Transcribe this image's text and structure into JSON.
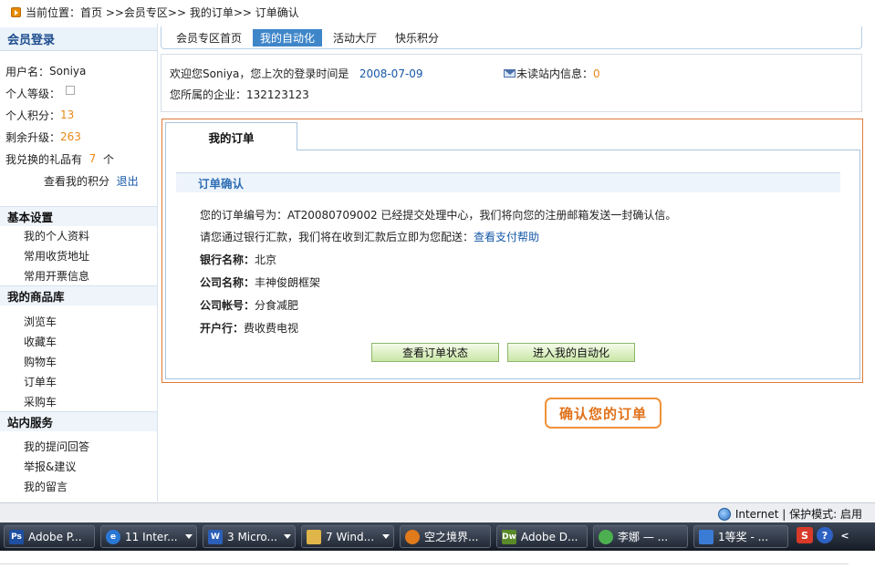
{
  "breadcrumb": {
    "text": "当前位置：首页 >>会员专区>> 我的订单>> 订单确认"
  },
  "sidebar": {
    "login_title": "会员登录",
    "username_label": "用户名：",
    "username": "Soniya",
    "level_label": "个人等级：",
    "points_label": "个人积分：",
    "points": "13",
    "remaining_label": "剩余升级：",
    "remaining": "263",
    "gifts_label": "我兑换的礼品有",
    "gifts_count": "7",
    "gifts_unit": "个",
    "view_points": "查看我的积分",
    "logout": "退出",
    "sections": [
      {
        "title": "基本设置",
        "items": [
          "我的个人资料",
          "常用收货地址",
          "常用开票信息"
        ]
      },
      {
        "title": "我的商品库",
        "items": [
          "浏览车",
          "收藏车",
          "购物车",
          "订单车",
          "采购车"
        ]
      },
      {
        "title": "站内服务",
        "items": [
          "我的提问回答",
          "举报&建议",
          "我的留言"
        ]
      }
    ]
  },
  "tabs": [
    "会员专区首页",
    "我的自动化",
    "活动大厅",
    "快乐积分"
  ],
  "welcome": {
    "greeting": "欢迎您Soniya，您上次的登录时间是",
    "last_login": "2008-07-09",
    "unread_label": "未读站内信息：",
    "unread_count": "0",
    "company_label": "您所属的企业：",
    "company": "132123123"
  },
  "order": {
    "tab_label": "我的订单",
    "section_title": "订单确认",
    "line1": "您的订单编号为：AT20080709002 已经提交处理中心，我们将向您的注册邮箱发送一封确认信。",
    "line2_text": "请您通过银行汇款，我们将在收到汇款后立即为您配送：",
    "line2_link": "查看支付帮助",
    "bank_label": "银行名称：",
    "bank": "北京",
    "company_label": "公司名称：",
    "company": "丰神俊朗框架",
    "account_label": "公司帐号：",
    "account": "分食减肥",
    "branch_label": "开户行：",
    "branch": "费收费电视",
    "btn_status": "查看订单状态",
    "btn_auto": "进入我的自动化"
  },
  "badge": "确认您的订单",
  "status_bar": {
    "zone": "Internet | 保护模式: 启用"
  },
  "taskbar": {
    "buttons": [
      {
        "icon": "Ps",
        "label": "Adobe P...",
        "color": "#1f4fa0"
      },
      {
        "icon": "e",
        "label": "11 Inter...",
        "color": "#2a78d6",
        "bold_prefix": true
      },
      {
        "icon": "W",
        "label": "3 Micro...",
        "color": "#2b5fb8",
        "bold_prefix": true
      },
      {
        "icon": "",
        "label": "7 Wind...",
        "color": "#e0b64a",
        "bold_prefix": true
      },
      {
        "icon": "",
        "label": "空之境界...",
        "color": "#e07a1a"
      },
      {
        "icon": "Dw",
        "label": "Adobe D...",
        "color": "#5a8a2a"
      },
      {
        "icon": "",
        "label": "李娜 — ...",
        "color": "#4caf50"
      },
      {
        "icon": "",
        "label": "1等奖 - ...",
        "color": "#3a7bd5"
      }
    ],
    "tray": [
      "S",
      "?",
      "<"
    ]
  },
  "colors": {
    "accent_blue": "#3f86c9",
    "orange": "#e8891a",
    "panel_border": "#e07a3a"
  }
}
